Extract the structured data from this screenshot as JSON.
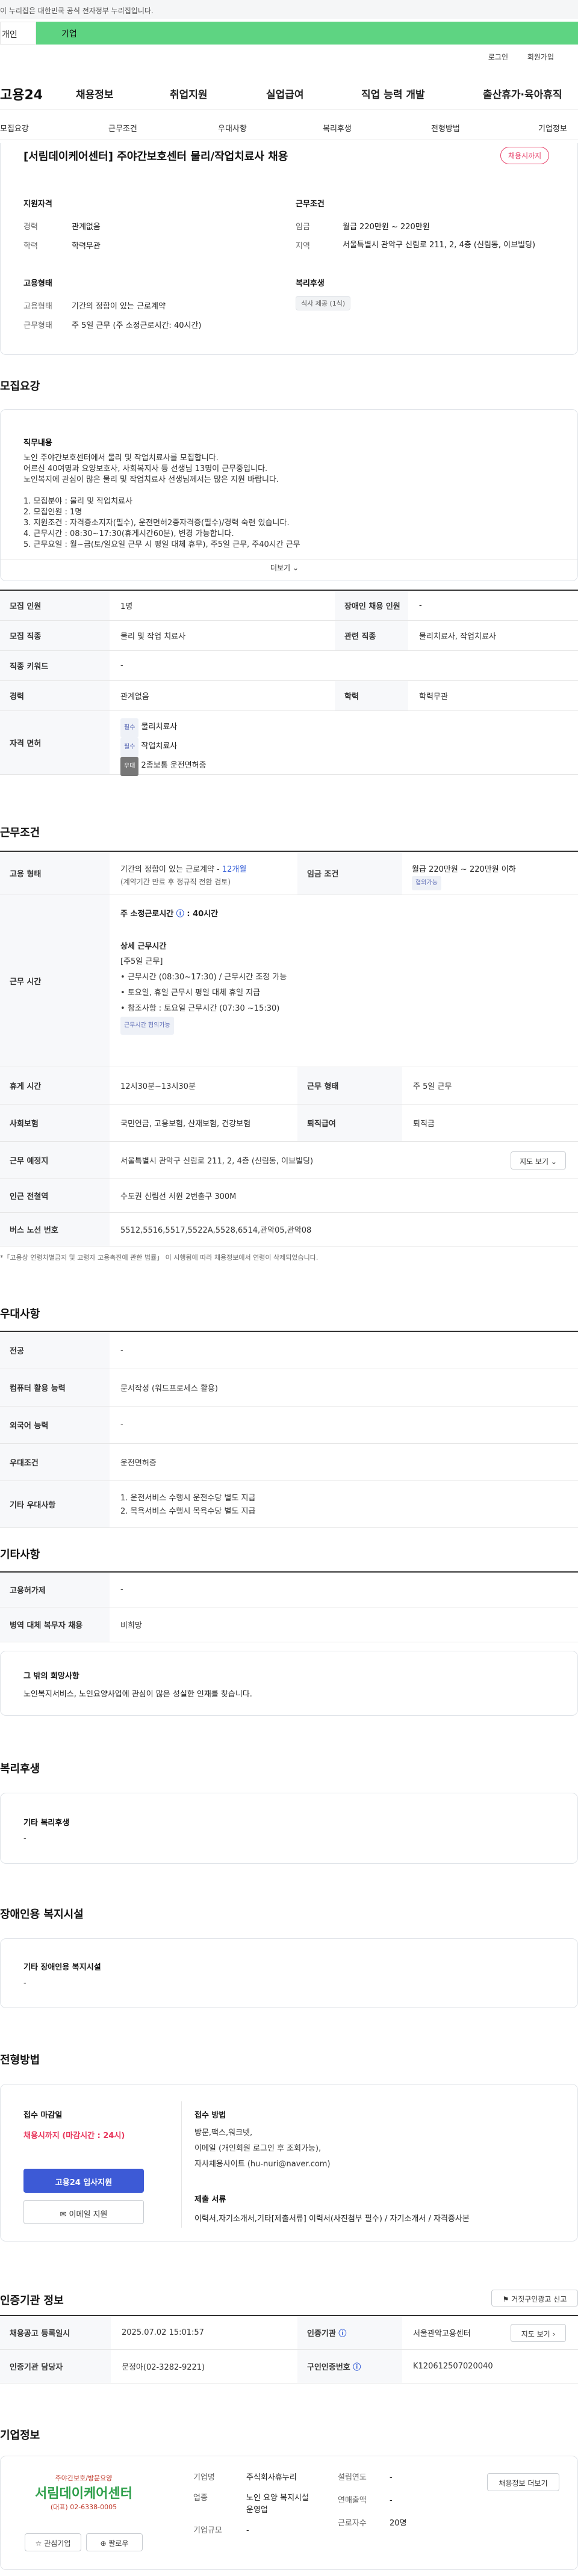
{
  "gov_banner": "이 누리집은 대한민국 공식 전자정부 누리집입니다.",
  "pill_bar": {
    "left": "개인",
    "right": "기업"
  },
  "top_links": {
    "login": "로그인",
    "signup": "회원가입"
  },
  "gnb": {
    "logo": "고용24",
    "items": [
      "채용정보",
      "취업지원",
      "실업급여",
      "직업 능력 개발",
      "출산휴가·육아휴직"
    ]
  },
  "subnav": [
    "모집요강",
    "근무조건",
    "우대사항",
    "복리후생",
    "전형방법",
    "기업정보"
  ],
  "summary": {
    "title": "[서림데이케어센터] 주야간보호센터 물리/작업치료사 채용",
    "deadline_badge": "채용시까지",
    "qual_head": "지원자격",
    "career_lbl": "경력",
    "career_val": "관계없음",
    "edu_lbl": "학력",
    "edu_val": "학력무관",
    "emp_head": "고용형태",
    "emp_lbl": "고용형태",
    "emp_val": "기간의 정함이 있는 근로계약",
    "work_lbl": "근무형태",
    "work_val": "주 5일 근무 (주 소정근로시간: 40시간)",
    "cond_head": "근무조건",
    "wage_lbl": "임금",
    "wage_val": "월급 220만원 ~ 220만원",
    "region_lbl": "지역",
    "region_val": "서울특별시 관악구 신림로 211, 2, 4층 (신림동, 이브빌딩)",
    "welfare_head": "복리후생",
    "welfare_tag": "식사 제공 (1식)"
  },
  "recruit": {
    "section": "모집요강",
    "duty_head": "직무내용",
    "duty_lines": [
      "노인 주야간보호센터에서 물리 및 작업치료사를 모집합니다.",
      "어르신 40여명과 요양보호사, 사회복지사 등 선생님 13명이 근무중입니다.",
      "노인복지에 관심이 많은 물리 및 작업치료사 선생님께서는 많은 지원 바랍니다.",
      "",
      "1. 모집분야 : 물리 및 작업치료사",
      "2. 모집인원 : 1명",
      "3. 지원조건 : 자격증소지자(필수), 운전면허2종자격증(필수)/경력 숙련 있습니다.",
      "4. 근무시간 : 08:30~17:30(휴게시간60분), 변경 가능합니다.",
      "5. 근무요일 : 월~금(토/일요일 근무 시 평일 대체 휴무), 주5일 근무, 주40시간 근무"
    ],
    "more": "더보기",
    "rows": [
      {
        "a": "모집 인원",
        "b": "1명",
        "c": "장애인 채용 인원",
        "d": "-"
      },
      {
        "a": "모집 직종",
        "b": "물리 및 작업 치료사",
        "c": "관련 직종",
        "d": "물리치료사, 작업치료사"
      },
      {
        "a": "직종 키워드",
        "b": "-"
      },
      {
        "a": "경력",
        "b": "관계없음",
        "c": "학력",
        "d": "학력무관"
      }
    ],
    "license_head": "자격 면허",
    "licenses": [
      {
        "tag": "필수",
        "name": "물리치료사"
      },
      {
        "tag": "필수",
        "name": "작업치료사"
      },
      {
        "tag": "우대",
        "name": "2종보통 운전면허증"
      }
    ]
  },
  "work": {
    "section": "근무조건",
    "emp_head": "고용 형태",
    "emp_val": "기간의 정함이 있는 근로계약 -",
    "emp_months": "12개월",
    "emp_note": "(계약기간 만료 후 정규직 전환 검토)",
    "wage_head": "임금 조건",
    "wage_val": "월급 220만원 ~ 220만원 이하",
    "wage_tag": "협의가능",
    "time_head": "근무 시간",
    "hours_label": "주 소정근로시간",
    "hours_val": "40시간",
    "detail_head": "상세 근무시간",
    "detail_sub": "[주5일 근무]",
    "detail_lines": [
      "근무시간 (08:30~17:30) / 근무시간 조정 가능",
      "토요일, 휴일 근무시 평일 대체 휴일 지급",
      "참조사항 : 토요일 근무시간 (07:30 ~15:30)"
    ],
    "detail_tag": "근무시간 협의가능",
    "rows": [
      {
        "a": "휴게 시간",
        "b": "12시30분~13시30분",
        "c": "근무 형태",
        "d": "주 5일 근무"
      },
      {
        "a": "사회보험",
        "b": "국민연금, 고용보험, 산재보험, 건강보험",
        "c": "퇴직급여",
        "d": "퇴직금"
      }
    ],
    "place_head": "근무 예정지",
    "place_val": "서울특별시 관악구 신림로 211, 2, 4층 (신림동, 이브빌딩)",
    "map_btn": "지도 보기",
    "station_head": "인근 전철역",
    "station_val": "수도권 신림선 서원 2번출구 300M",
    "bus_head": "버스 노선 번호",
    "bus_val": "5512,5516,5517,5522A,5528,6514,관악05,관악08",
    "footnote": "*「고용상 연령차별금지 및 고령자 고용촉진에 관한 법률」 이 시행됨에 따라 채용정보에서 연령이 삭제되었습니다."
  },
  "pref": {
    "section": "우대사항",
    "rows": [
      {
        "a": "전공",
        "b": "-"
      },
      {
        "a": "컴퓨터 활용 능력",
        "b": "문서작성 (워드프로세스 활용)"
      },
      {
        "a": "외국어 능력",
        "b": "-"
      },
      {
        "a": "우대조건",
        "b": "운전면허증"
      }
    ],
    "other_head": "기타 우대사항",
    "other_lines": [
      "1. 운전서비스 수행시 운전수당 별도 지급",
      "2. 목욕서비스 수행시 목욕수당 별도 지급"
    ]
  },
  "etc": {
    "section": "기타사항",
    "rows": [
      {
        "a": "고용허가제",
        "b": "-"
      },
      {
        "a": "병역 대체 복무자 채용",
        "b": "비희망"
      }
    ],
    "hope_head": "그 밖의 희망사항",
    "hope_val": "노인복지서비스, 노인요양사업에 관심이 많은 성실한 인재를 찾습니다."
  },
  "welfare": {
    "section": "복리후생",
    "head": "기타 복리후생",
    "val": "-"
  },
  "disabled": {
    "section": "장애인용 복지시설",
    "head": "기타 장애인용 복지시설",
    "val": "-"
  },
  "screening": {
    "section": "전형방법",
    "deadline_head": "접수 마감일",
    "deadline_val": "채용시까지 (마감시간 : 24시)",
    "apply_btn": "고용24 입사지원",
    "email_btn": "이메일 지원",
    "method_head": "접수 방법",
    "method_lines": [
      "방문,팩스,워크넷,",
      "이메일 (개인회원 로그인 후 조회가능),",
      "자사채용사이트 (hu-nuri@naver.com)"
    ],
    "docs_head": "제출 서류",
    "docs_val": "이력서,자기소개서,기타[제출서류] 이력서(사진첨부 필수) / 자기소개서 / 자격증사본"
  },
  "cert": {
    "section": "인증기관 정보",
    "report_btn": "거짓구인광고 신고",
    "rows": [
      {
        "a": "채용공고 등록일시",
        "b": "2025.07.02 15:01:57",
        "c": "인증기관",
        "d": "서울관악고용센터",
        "btn": "지도 보기"
      },
      {
        "a": "인증기관 담당자",
        "b": "문정아(02-3282-9221)",
        "c": "구인인증번호",
        "d": "K120612507020040"
      }
    ]
  },
  "company": {
    "section": "기업정보",
    "logo_top": "주야간보호/방문요양",
    "logo_name": "서림데이케어센터",
    "logo_phone": "(대표) 02-6338-0005",
    "fav_btn": "관심기업",
    "follow_btn": "팔로우",
    "fields": [
      {
        "a": "기업명",
        "b": "주식회사휴누리"
      },
      {
        "a": "업종",
        "b": "노인 요양 복지시설 운영업"
      },
      {
        "a": "기업규모",
        "b": "-"
      }
    ],
    "fields2": [
      {
        "a": "설립연도",
        "b": "-"
      },
      {
        "a": "연매출액",
        "b": "-"
      },
      {
        "a": "근로자수",
        "b": "20명"
      }
    ],
    "more_btn": "채용정보 더보기"
  }
}
